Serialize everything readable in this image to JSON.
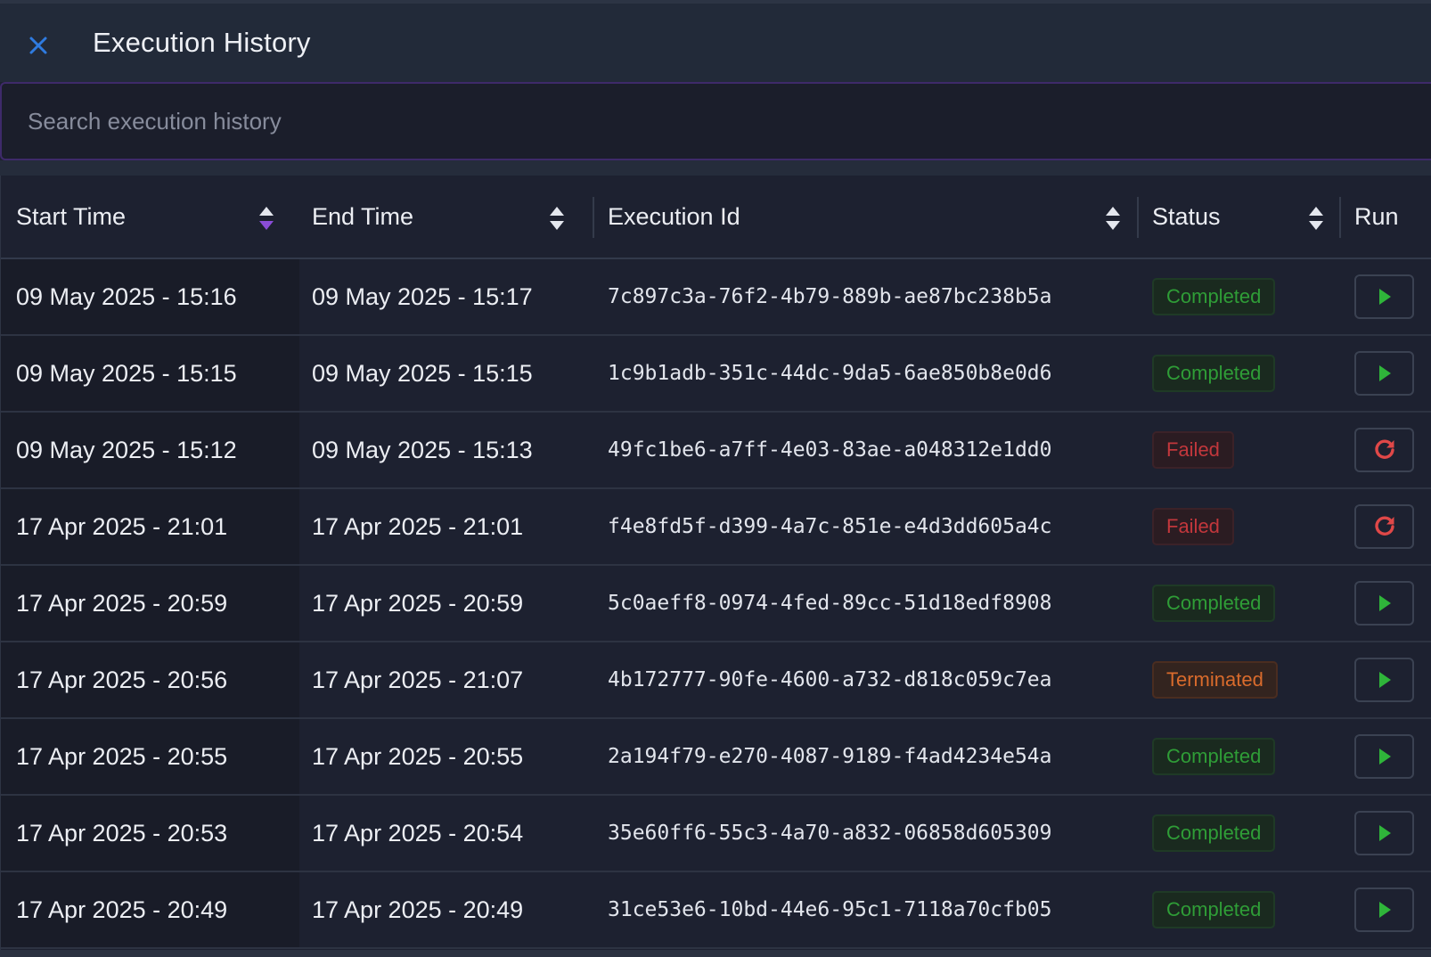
{
  "header": {
    "title": "Execution History",
    "close_icon": "close-icon",
    "close_color": "#2f7be0"
  },
  "search": {
    "placeholder": "Search execution history",
    "value": ""
  },
  "table": {
    "columns": {
      "start_time": "Start Time",
      "end_time": "End Time",
      "execution_id": "Execution Id",
      "status": "Status",
      "run": "Run"
    },
    "rows": [
      {
        "start": "09 May 2025 - 15:16",
        "end": "09 May 2025 - 15:17",
        "id": "7c897c3a-76f2-4b79-889b-ae87bc238b5a",
        "status": "Completed",
        "action_icon": "play-icon"
      },
      {
        "start": "09 May 2025 - 15:15",
        "end": "09 May 2025 - 15:15",
        "id": "1c9b1adb-351c-44dc-9da5-6ae850b8e0d6",
        "status": "Completed",
        "action_icon": "play-icon"
      },
      {
        "start": "09 May 2025 - 15:12",
        "end": "09 May 2025 - 15:13",
        "id": "49fc1be6-a7ff-4e03-83ae-a048312e1dd0",
        "status": "Failed",
        "action_icon": "retry-icon"
      },
      {
        "start": "17 Apr 2025 - 21:01",
        "end": "17 Apr 2025 - 21:01",
        "id": "f4e8fd5f-d399-4a7c-851e-e4d3dd605a4c",
        "status": "Failed",
        "action_icon": "retry-icon"
      },
      {
        "start": "17 Apr 2025 - 20:59",
        "end": "17 Apr 2025 - 20:59",
        "id": "5c0aeff8-0974-4fed-89cc-51d18edf8908",
        "status": "Completed",
        "action_icon": "play-icon"
      },
      {
        "start": "17 Apr 2025 - 20:56",
        "end": "17 Apr 2025 - 21:07",
        "id": "4b172777-90fe-4600-a732-d818c059c7ea",
        "status": "Terminated",
        "action_icon": "play-icon"
      },
      {
        "start": "17 Apr 2025 - 20:55",
        "end": "17 Apr 2025 - 20:55",
        "id": "2a194f79-e270-4087-9189-f4ad4234e54a",
        "status": "Completed",
        "action_icon": "play-icon"
      },
      {
        "start": "17 Apr 2025 - 20:53",
        "end": "17 Apr 2025 - 20:54",
        "id": "35e60ff6-55c3-4a70-a832-06858d605309",
        "status": "Completed",
        "action_icon": "play-icon"
      },
      {
        "start": "17 Apr 2025 - 20:49",
        "end": "17 Apr 2025 - 20:49",
        "id": "31ce53e6-10bd-44e6-95c1-7118a70cfb05",
        "status": "Completed",
        "action_icon": "play-icon"
      }
    ]
  },
  "colors": {
    "completed": "#2f9d37",
    "failed": "#c2373c",
    "terminated": "#d96b2c",
    "play_icon": "#2fb53a",
    "retry_icon": "#e04848",
    "sort_active": "#8a4dd8",
    "sort_inactive": "#e4e7ee"
  }
}
